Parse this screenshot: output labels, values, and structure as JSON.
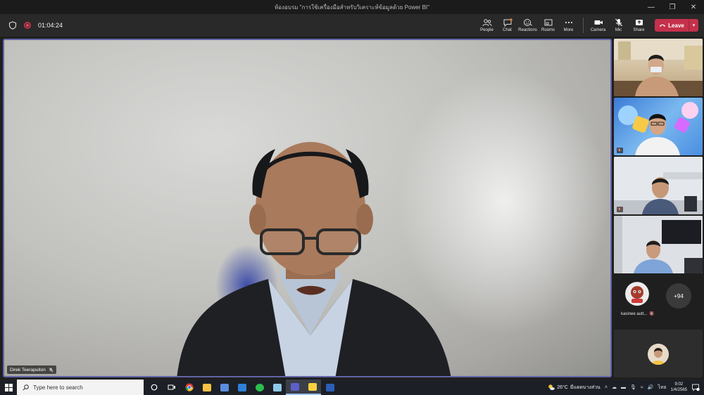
{
  "window": {
    "title": "ห้องอบรม \"การใช้เครื่องมือสำหรับวิเคราะห์ข้อมูลด้วย Power BI\""
  },
  "meeting": {
    "elapsed": "01:04:24"
  },
  "toolbar": {
    "people_label": "People",
    "chat_label": "Chat",
    "reactions_label": "Reactions",
    "rooms_label": "Rooms",
    "more_label": "More",
    "camera_label": "Camera",
    "mic_label": "Mic",
    "share_label": "Share",
    "leave_label": "Leave"
  },
  "stage": {
    "speaker_name": "Direk Teerapuiton"
  },
  "side_panel": {
    "avatar_name": "kasinee autt...",
    "overflow_count": "+94"
  },
  "taskbar": {
    "search_placeholder": "Type here to search",
    "weather_temp": "26°C",
    "weather_text": "มีแดดบางส่วน",
    "language": "ไทย",
    "time": "9:02",
    "date": "1/4/2565"
  },
  "colors": {
    "accent": "#6264a7",
    "leave": "#c4314b",
    "toolbar_bg": "#292929"
  }
}
